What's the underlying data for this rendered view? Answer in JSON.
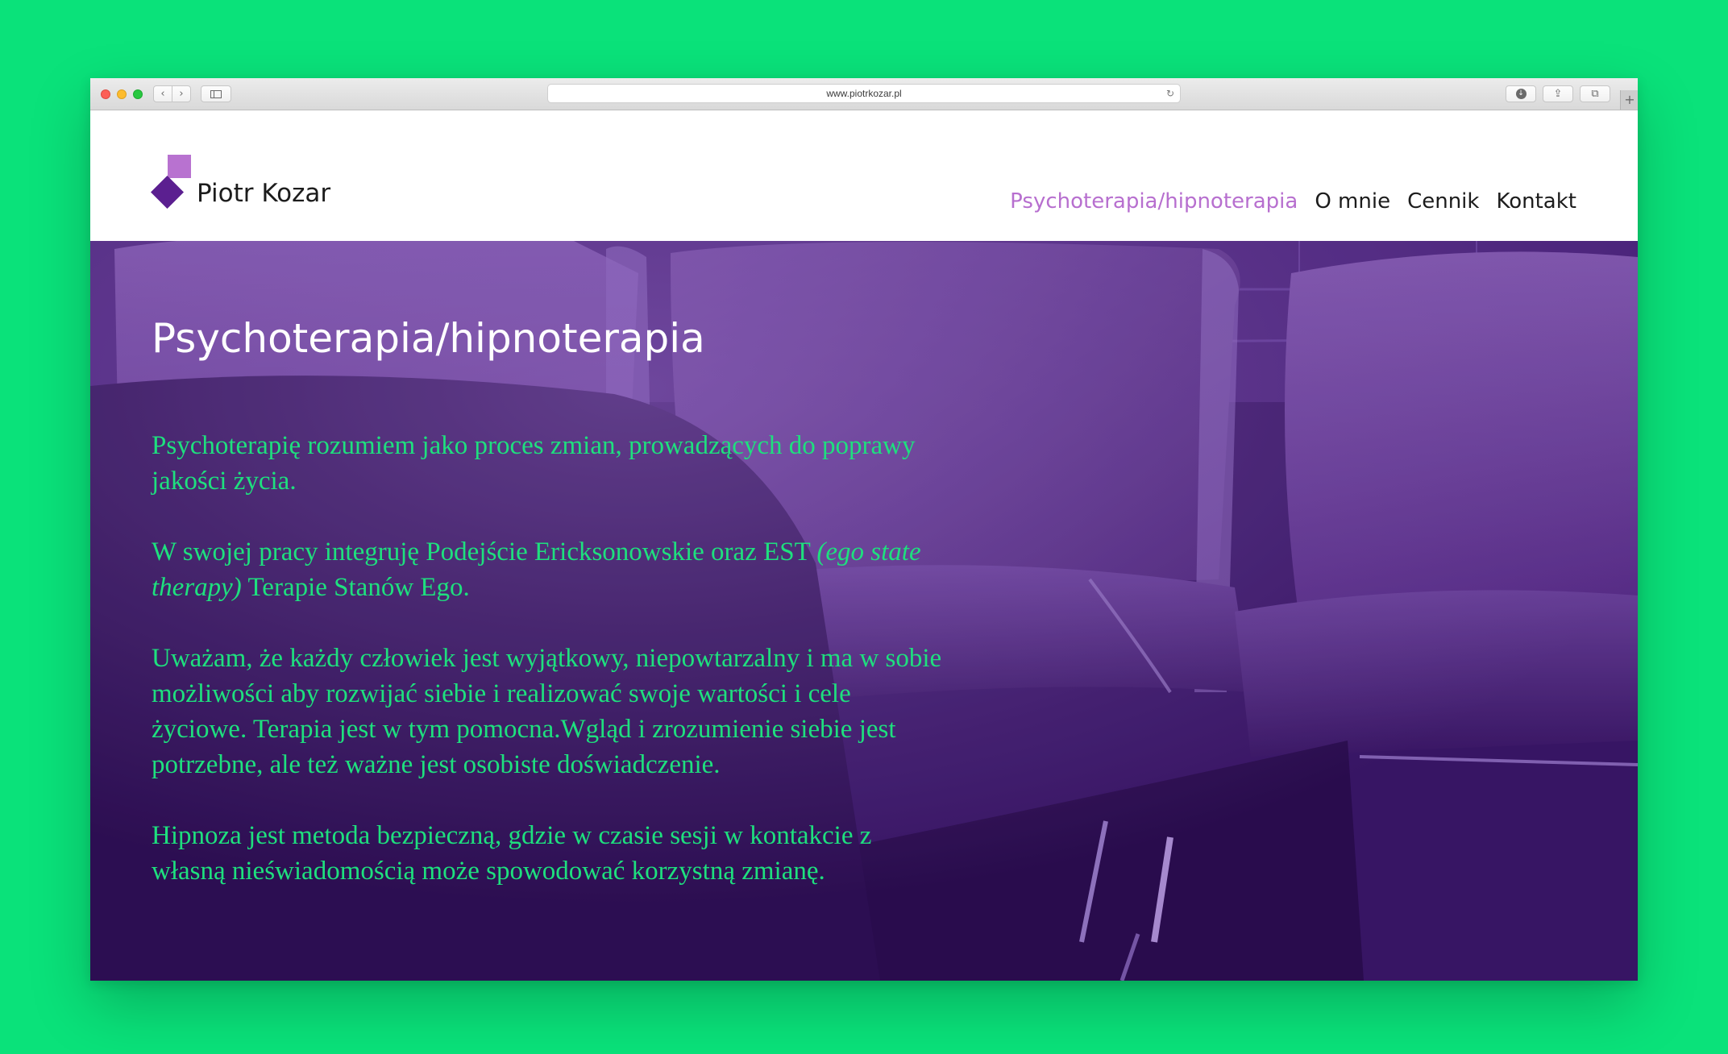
{
  "browser": {
    "url": "www.piotrkozar.pl",
    "back_glyph": "‹",
    "forward_glyph": "›",
    "reload_glyph": "↻",
    "download_glyph": "↓",
    "share_glyph": "⇪",
    "tabs_glyph": "⧉",
    "newtab_glyph": "+",
    "icons": [
      "close-light",
      "minimize-light",
      "zoom-light",
      "back-icon",
      "forward-icon",
      "sidebar-icon",
      "reload-icon",
      "download-icon",
      "share-icon",
      "tabs-icon",
      "new-tab-icon"
    ]
  },
  "site": {
    "logo_text": "Piotr Kozar",
    "brand_colors": {
      "light_purple": "#b872d0",
      "dark_purple": "#5b1f90",
      "green": "#1ee07e"
    },
    "nav": [
      {
        "label": "Psychoterapia/hipnoterapia",
        "active": true
      },
      {
        "label": "O mnie",
        "active": false
      },
      {
        "label": "Cennik",
        "active": false
      },
      {
        "label": "Kontakt",
        "active": false
      }
    ]
  },
  "hero": {
    "title": "Psychoterapia/hipnoterapia",
    "p1": "Psychoterapię rozumiem jako proces zmian, prowadzących do poprawy jakości życia.",
    "p2_a": "W swojej pracy integruję Podejście Ericksonowskie oraz EST ",
    "p2_em": "(ego state therapy)",
    "p2_b": " Terapie Stanów Ego.",
    "p3": "Uważam, że każdy człowiek jest wyjątkowy, niepowtarzalny i ma w sobie możliwości aby rozwijać siebie i realizować swoje wartości i cele życiowe. Terapia jest w tym pomocna.Wgląd i zrozumienie siebie jest potrzebne, ale też ważne jest osobiste doświadczenie.",
    "p4": "Hipnoza jest metoda bezpieczną, gdzie w czasie sesji w kontakcie z własną nieświadomością może spowodować korzystną zmianę."
  }
}
